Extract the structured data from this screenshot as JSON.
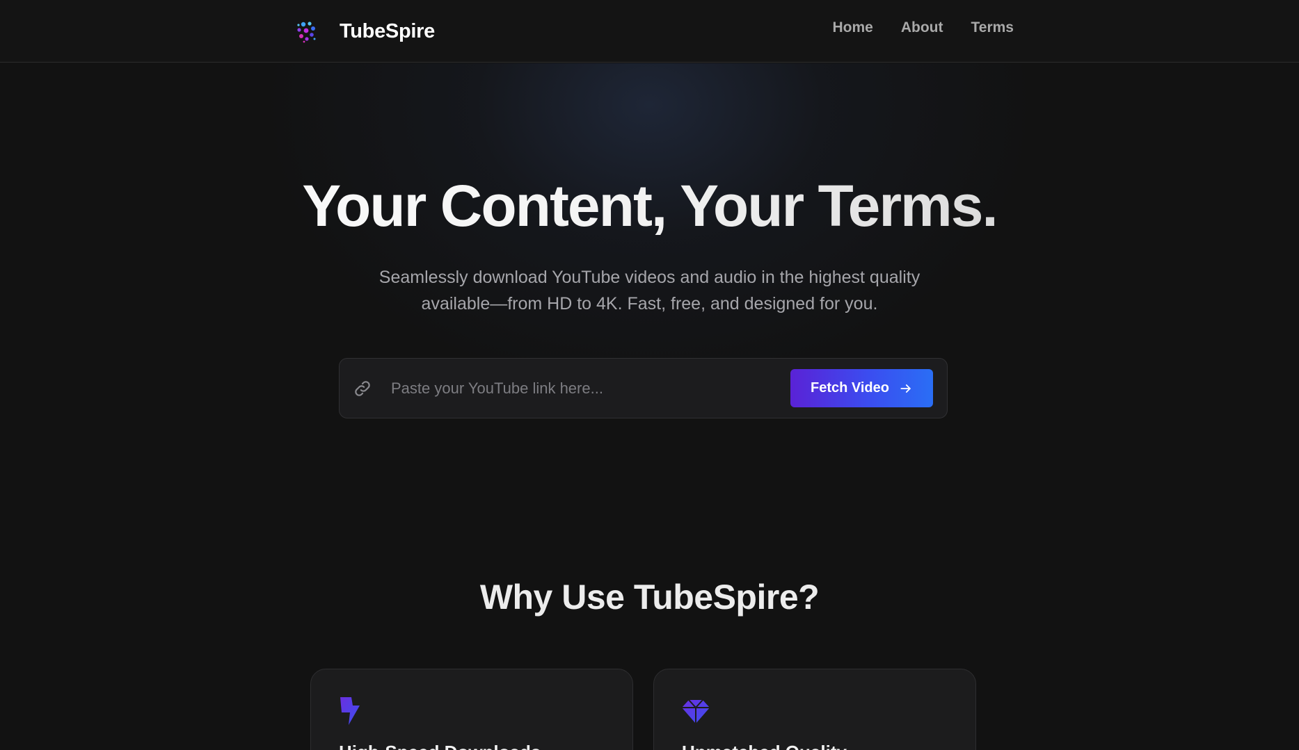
{
  "header": {
    "brand_name": "TubeSpire",
    "logo_icon": "molecule-logo-icon",
    "nav": [
      {
        "label": "Home"
      },
      {
        "label": "About"
      },
      {
        "label": "Terms"
      }
    ]
  },
  "hero": {
    "title": "Your Content, Your Terms.",
    "subtitle_line1": "Seamlessly download YouTube videos and audio in the highest quality",
    "subtitle_line2": "available—from HD to 4K. Fast, free, and designed for you."
  },
  "search": {
    "icon": "link-icon",
    "placeholder": "Paste your YouTube link here...",
    "value": "",
    "button_label": "Fetch Video",
    "button_icon": "arrow-right-icon"
  },
  "features": {
    "title": "Why Use TubeSpire?",
    "cards": [
      {
        "icon": "lightning-bolt-icon",
        "title": "High-Speed Downloads"
      },
      {
        "icon": "diamond-gem-icon",
        "title": "Unmatched Quality"
      }
    ]
  },
  "colors": {
    "background": "#121212",
    "accent_start": "#5a22d6",
    "accent_end": "#2a6ef5",
    "icon_purple": "#4b3ff0"
  }
}
